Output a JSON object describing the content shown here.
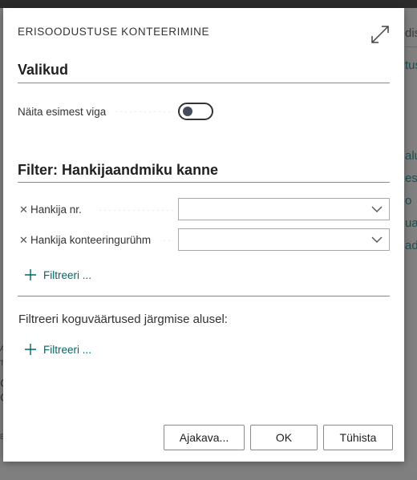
{
  "background": {
    "right_texts": [
      "dis",
      "tus",
      "alu",
      "esa",
      "o",
      "ua",
      "ad"
    ],
    "left_fragments": [
      "A",
      "T",
      "C",
      "C",
      "E"
    ]
  },
  "dialog": {
    "title": "ERISOODUSTUSE KONTEERIMINE",
    "expand_icon": "expand-diagonal-icon",
    "options_section": {
      "title": "Valikud",
      "show_error_label": "Näita esimest viga",
      "show_error_enabled": false
    },
    "filter_section": {
      "title": "Filter: Hankijaandmiku kanne",
      "fields": [
        {
          "label": "Hankija nr.",
          "value": ""
        },
        {
          "label": "Hankija konteeringurühm",
          "value": ""
        }
      ],
      "add_filter_label": "Filtreeri ..."
    },
    "totals_section": {
      "caption": "Filtreeri koguväärtused järgmise alusel:",
      "add_filter_label": "Filtreeri ..."
    },
    "buttons": {
      "schedule": "Ajakava...",
      "ok": "OK",
      "cancel": "Tühista"
    }
  },
  "colors": {
    "accent": "#006666",
    "overlay": "#808080"
  }
}
